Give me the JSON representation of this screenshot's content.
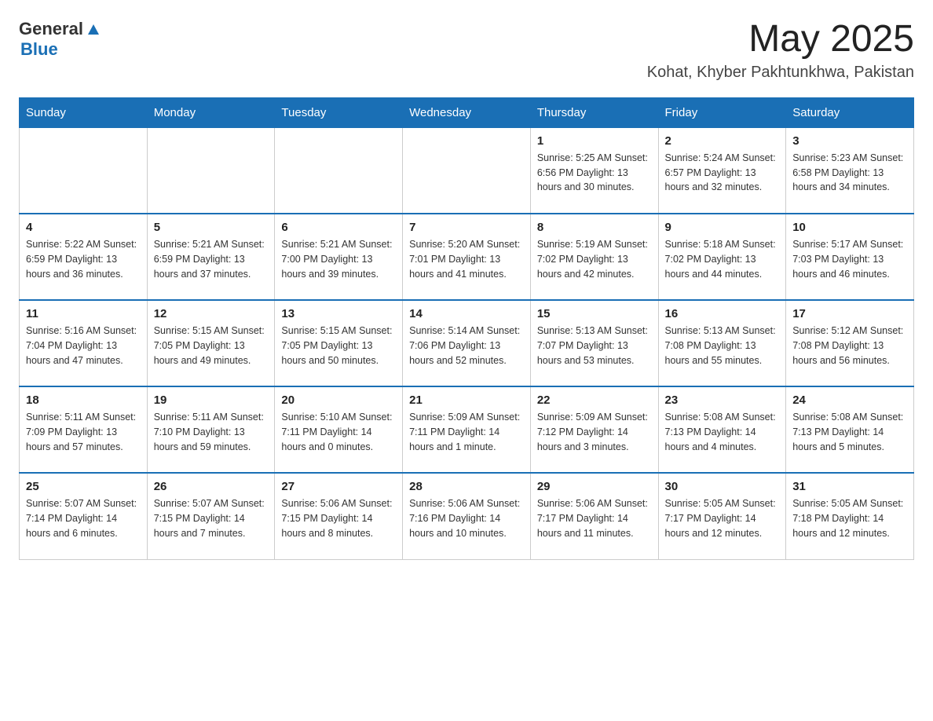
{
  "logo": {
    "text_general": "General",
    "triangle": "▲",
    "text_blue": "Blue"
  },
  "header": {
    "title": "May 2025",
    "subtitle": "Kohat, Khyber Pakhtunkhwa, Pakistan"
  },
  "weekdays": [
    "Sunday",
    "Monday",
    "Tuesday",
    "Wednesday",
    "Thursday",
    "Friday",
    "Saturday"
  ],
  "weeks": [
    [
      {
        "day": "",
        "info": ""
      },
      {
        "day": "",
        "info": ""
      },
      {
        "day": "",
        "info": ""
      },
      {
        "day": "",
        "info": ""
      },
      {
        "day": "1",
        "info": "Sunrise: 5:25 AM\nSunset: 6:56 PM\nDaylight: 13 hours\nand 30 minutes."
      },
      {
        "day": "2",
        "info": "Sunrise: 5:24 AM\nSunset: 6:57 PM\nDaylight: 13 hours\nand 32 minutes."
      },
      {
        "day": "3",
        "info": "Sunrise: 5:23 AM\nSunset: 6:58 PM\nDaylight: 13 hours\nand 34 minutes."
      }
    ],
    [
      {
        "day": "4",
        "info": "Sunrise: 5:22 AM\nSunset: 6:59 PM\nDaylight: 13 hours\nand 36 minutes."
      },
      {
        "day": "5",
        "info": "Sunrise: 5:21 AM\nSunset: 6:59 PM\nDaylight: 13 hours\nand 37 minutes."
      },
      {
        "day": "6",
        "info": "Sunrise: 5:21 AM\nSunset: 7:00 PM\nDaylight: 13 hours\nand 39 minutes."
      },
      {
        "day": "7",
        "info": "Sunrise: 5:20 AM\nSunset: 7:01 PM\nDaylight: 13 hours\nand 41 minutes."
      },
      {
        "day": "8",
        "info": "Sunrise: 5:19 AM\nSunset: 7:02 PM\nDaylight: 13 hours\nand 42 minutes."
      },
      {
        "day": "9",
        "info": "Sunrise: 5:18 AM\nSunset: 7:02 PM\nDaylight: 13 hours\nand 44 minutes."
      },
      {
        "day": "10",
        "info": "Sunrise: 5:17 AM\nSunset: 7:03 PM\nDaylight: 13 hours\nand 46 minutes."
      }
    ],
    [
      {
        "day": "11",
        "info": "Sunrise: 5:16 AM\nSunset: 7:04 PM\nDaylight: 13 hours\nand 47 minutes."
      },
      {
        "day": "12",
        "info": "Sunrise: 5:15 AM\nSunset: 7:05 PM\nDaylight: 13 hours\nand 49 minutes."
      },
      {
        "day": "13",
        "info": "Sunrise: 5:15 AM\nSunset: 7:05 PM\nDaylight: 13 hours\nand 50 minutes."
      },
      {
        "day": "14",
        "info": "Sunrise: 5:14 AM\nSunset: 7:06 PM\nDaylight: 13 hours\nand 52 minutes."
      },
      {
        "day": "15",
        "info": "Sunrise: 5:13 AM\nSunset: 7:07 PM\nDaylight: 13 hours\nand 53 minutes."
      },
      {
        "day": "16",
        "info": "Sunrise: 5:13 AM\nSunset: 7:08 PM\nDaylight: 13 hours\nand 55 minutes."
      },
      {
        "day": "17",
        "info": "Sunrise: 5:12 AM\nSunset: 7:08 PM\nDaylight: 13 hours\nand 56 minutes."
      }
    ],
    [
      {
        "day": "18",
        "info": "Sunrise: 5:11 AM\nSunset: 7:09 PM\nDaylight: 13 hours\nand 57 minutes."
      },
      {
        "day": "19",
        "info": "Sunrise: 5:11 AM\nSunset: 7:10 PM\nDaylight: 13 hours\nand 59 minutes."
      },
      {
        "day": "20",
        "info": "Sunrise: 5:10 AM\nSunset: 7:11 PM\nDaylight: 14 hours\nand 0 minutes."
      },
      {
        "day": "21",
        "info": "Sunrise: 5:09 AM\nSunset: 7:11 PM\nDaylight: 14 hours\nand 1 minute."
      },
      {
        "day": "22",
        "info": "Sunrise: 5:09 AM\nSunset: 7:12 PM\nDaylight: 14 hours\nand 3 minutes."
      },
      {
        "day": "23",
        "info": "Sunrise: 5:08 AM\nSunset: 7:13 PM\nDaylight: 14 hours\nand 4 minutes."
      },
      {
        "day": "24",
        "info": "Sunrise: 5:08 AM\nSunset: 7:13 PM\nDaylight: 14 hours\nand 5 minutes."
      }
    ],
    [
      {
        "day": "25",
        "info": "Sunrise: 5:07 AM\nSunset: 7:14 PM\nDaylight: 14 hours\nand 6 minutes."
      },
      {
        "day": "26",
        "info": "Sunrise: 5:07 AM\nSunset: 7:15 PM\nDaylight: 14 hours\nand 7 minutes."
      },
      {
        "day": "27",
        "info": "Sunrise: 5:06 AM\nSunset: 7:15 PM\nDaylight: 14 hours\nand 8 minutes."
      },
      {
        "day": "28",
        "info": "Sunrise: 5:06 AM\nSunset: 7:16 PM\nDaylight: 14 hours\nand 10 minutes."
      },
      {
        "day": "29",
        "info": "Sunrise: 5:06 AM\nSunset: 7:17 PM\nDaylight: 14 hours\nand 11 minutes."
      },
      {
        "day": "30",
        "info": "Sunrise: 5:05 AM\nSunset: 7:17 PM\nDaylight: 14 hours\nand 12 minutes."
      },
      {
        "day": "31",
        "info": "Sunrise: 5:05 AM\nSunset: 7:18 PM\nDaylight: 14 hours\nand 12 minutes."
      }
    ]
  ]
}
